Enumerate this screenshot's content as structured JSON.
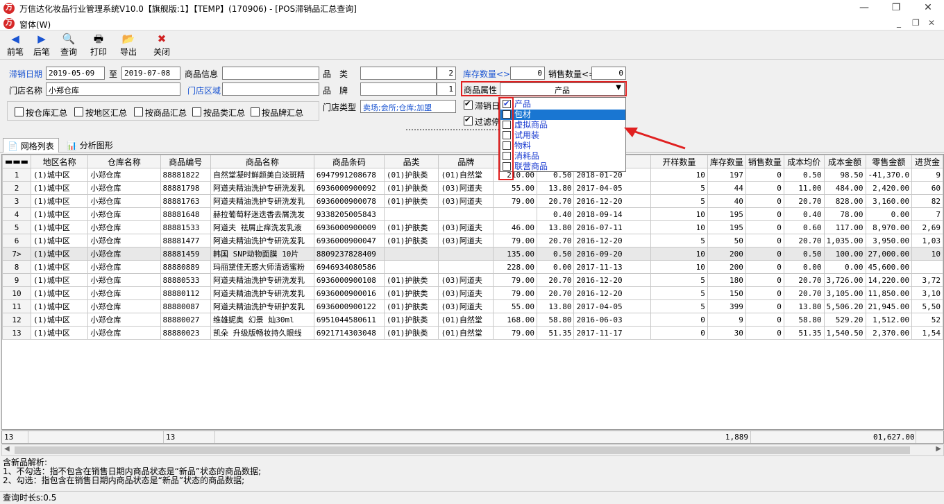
{
  "window": {
    "title": "万信达化妆品行业管理系统V10.0【旗舰版:1】【TEMP】(170906) - [POS滞销品汇总查询]",
    "menu_label": "窗体(W)",
    "min_label": "—",
    "max_label": "❐",
    "close_label": "✕",
    "mdi_controls": [
      "_",
      "❐",
      "✕"
    ]
  },
  "toolbar": [
    {
      "key": "prev",
      "label": "前笔",
      "icon": "◀"
    },
    {
      "key": "next",
      "label": "后笔",
      "icon": "▶"
    },
    {
      "key": "query",
      "label": "查询",
      "icon": "🔍"
    },
    {
      "key": "print",
      "label": "打印",
      "icon": "🖶"
    },
    {
      "key": "export",
      "label": "导出",
      "icon": "📂"
    },
    {
      "key": "close",
      "label": "关闭",
      "icon": "✖"
    }
  ],
  "filters": {
    "slow_date_label": "滞销日期",
    "date_from": "2019-05-09",
    "date_to_label": "至",
    "date_to": "2019-07-08",
    "product_info_label": "商品信息",
    "product_info": "",
    "category_label": "品　类",
    "category": "",
    "category_count": "2",
    "brand_label": "品　牌",
    "brand": "",
    "brand_count": "1",
    "store_name_label": "门店名称",
    "store_name": "小郑仓库",
    "store_area_label": "门店区域",
    "store_area": "",
    "stock_qty_label": "库存数量<>",
    "stock_qty": "0",
    "sales_qty_label": "销售数量<=",
    "sales_qty": "0",
    "product_attr_label": "商品属性",
    "product_attr": "产品",
    "store_type_label": "门店类型",
    "store_type": "卖场;会所;仓库;加盟",
    "slow_check_label": "滞销日",
    "filter_check_label": "过滤停",
    "group_by": [
      {
        "label": "按仓库汇总",
        "checked": false
      },
      {
        "label": "按地区汇总",
        "checked": false
      },
      {
        "label": "按商品汇总",
        "checked": false
      },
      {
        "label": "按品类汇总",
        "checked": false
      },
      {
        "label": "按品牌汇总",
        "checked": false
      }
    ]
  },
  "attr_dropdown": [
    {
      "label": "产品",
      "checked": true,
      "highlighted": false
    },
    {
      "label": "包材",
      "checked": false,
      "highlighted": true
    },
    {
      "label": "虚拟商品",
      "checked": false,
      "highlighted": false
    },
    {
      "label": "试用装",
      "checked": false,
      "highlighted": false
    },
    {
      "label": "物料",
      "checked": false,
      "highlighted": false
    },
    {
      "label": "消耗品",
      "checked": false,
      "highlighted": false
    },
    {
      "label": "联营商品",
      "checked": false,
      "highlighted": false
    }
  ],
  "tabs": [
    {
      "label": "网格列表",
      "icon": "📄",
      "active": true
    },
    {
      "label": "分析图形",
      "icon": "📊",
      "active": false
    }
  ],
  "table": {
    "columns": [
      "",
      "地区名称",
      "仓库名称",
      "商品编号",
      "商品名称",
      "商品条码",
      "品类",
      "品牌",
      "",
      "",
      "日期",
      "开样数量",
      "库存数量",
      "销售数量",
      "成本均价",
      "成本金额",
      "零售金额",
      "进货金"
    ],
    "rows": [
      [
        "1",
        "(1)城中区",
        "小郑仓库",
        "88881822",
        "自然堂凝时鲜颜美白淡斑精",
        "6947991208678",
        "(01)护肤类",
        "(01)自然堂",
        "210.00",
        "0.50",
        "2018-01-20",
        "10",
        "197",
        "0",
        "0.50",
        "98.50",
        "-41,370.0",
        "9"
      ],
      [
        "2",
        "(1)城中区",
        "小郑仓库",
        "88881798",
        "阿道夫精油洗护专研洗发乳",
        "6936000900092",
        "(01)护肤类",
        "(03)阿道夫",
        "55.00",
        "13.80",
        "2017-04-05",
        "5",
        "44",
        "0",
        "11.00",
        "484.00",
        "2,420.00",
        "60"
      ],
      [
        "3",
        "(1)城中区",
        "小郑仓库",
        "88881763",
        "阿道夫精油洗护专研洗发乳",
        "6936000900078",
        "(01)护肤类",
        "(03)阿道夫",
        "79.00",
        "20.70",
        "2016-12-20",
        "5",
        "40",
        "0",
        "20.70",
        "828.00",
        "3,160.00",
        "82"
      ],
      [
        "4",
        "(1)城中区",
        "小郑仓库",
        "88881648",
        "赫拉葡萄籽迷迭香去屑洗发",
        "9338205005843",
        "",
        "",
        "",
        "0.40",
        "2018-09-14",
        "10",
        "195",
        "0",
        "0.40",
        "78.00",
        "0.00",
        "7"
      ],
      [
        "5",
        "(1)城中区",
        "小郑仓库",
        "88881533",
        "阿道夫 祛屑止痒洗发乳液",
        "6936000900009",
        "(01)护肤类",
        "(03)阿道夫",
        "46.00",
        "13.80",
        "2016-07-11",
        "10",
        "195",
        "0",
        "0.60",
        "117.00",
        "8,970.00",
        "2,69"
      ],
      [
        "6",
        "(1)城中区",
        "小郑仓库",
        "88881477",
        "阿道夫精油洗护专研洗发乳",
        "6936000900047",
        "(01)护肤类",
        "(03)阿道夫",
        "79.00",
        "20.70",
        "2016-12-20",
        "5",
        "50",
        "0",
        "20.70",
        "1,035.00",
        "3,950.00",
        "1,03"
      ],
      [
        "7>",
        "(1)城中区",
        "小郑仓库",
        "88881459",
        "韩国 SNP动物面膜 10片",
        "8809237828409",
        "",
        "",
        "135.00",
        "0.50",
        "2016-09-20",
        "10",
        "200",
        "0",
        "0.50",
        "100.00",
        "27,000.00",
        "10"
      ],
      [
        "8",
        "(1)城中区",
        "小郑仓库",
        "88880889",
        "玛丽黛佳无惑大师清透蜜粉",
        "6946934080586",
        "",
        "",
        "228.00",
        "0.00",
        "2017-11-13",
        "10",
        "200",
        "0",
        "0.00",
        "0.00",
        "45,600.00",
        ""
      ],
      [
        "9",
        "(1)城中区",
        "小郑仓库",
        "88880533",
        "阿道夫精油洗护专研洗发乳",
        "6936000900108",
        "(01)护肤类",
        "(03)阿道夫",
        "79.00",
        "20.70",
        "2016-12-20",
        "5",
        "180",
        "0",
        "20.70",
        "3,726.00",
        "14,220.00",
        "3,72"
      ],
      [
        "10",
        "(1)城中区",
        "小郑仓库",
        "88880112",
        "阿道夫精油洗护专研洗发乳",
        "6936000900016",
        "(01)护肤类",
        "(03)阿道夫",
        "79.00",
        "20.70",
        "2016-12-20",
        "5",
        "150",
        "0",
        "20.70",
        "3,105.00",
        "11,850.00",
        "3,10"
      ],
      [
        "11",
        "(1)城中区",
        "小郑仓库",
        "88880087",
        "阿道夫精油洗护专研护发乳",
        "6936000900122",
        "(01)护肤类",
        "(03)阿道夫",
        "55.00",
        "13.80",
        "2017-04-05",
        "5",
        "399",
        "0",
        "13.80",
        "5,506.20",
        "21,945.00",
        "5,50"
      ],
      [
        "12",
        "(1)城中区",
        "小郑仓库",
        "88880027",
        "维雄妮奥 幻景 灿30ml",
        "6951044580611",
        "(01)护肤类",
        "(01)自然堂",
        "168.00",
        "58.80",
        "2016-06-03",
        "0",
        "9",
        "0",
        "58.80",
        "529.20",
        "1,512.00",
        "52"
      ],
      [
        "13",
        "(1)城中区",
        "小郑仓库",
        "88880023",
        "凯朵 升级版畅妆持久眼线",
        "6921714303048",
        "(01)护肤类",
        "(01)自然堂",
        "79.00",
        "51.35",
        "2017-11-17",
        "0",
        "30",
        "0",
        "51.35",
        "1,540.50",
        "2,370.00",
        "1,54"
      ]
    ]
  },
  "footer": {
    "count": "13",
    "code_count": "13",
    "stock_total": "1,889",
    "retail_total": "01,627.00"
  },
  "notes": [
    "含新品解析:",
    "1、不勾选：指不包含在销售日期内商品状态是“新品”状态的商品数据;",
    "2、勾选：指包含在销售日期内商品状态是“新品”状态的商品数据;"
  ],
  "status": "查询时长s:0.5",
  "colors": {
    "accent": "#1b55d2",
    "highlight": "#1976d2",
    "annotation": "#e02020",
    "logo": "#d62828"
  }
}
